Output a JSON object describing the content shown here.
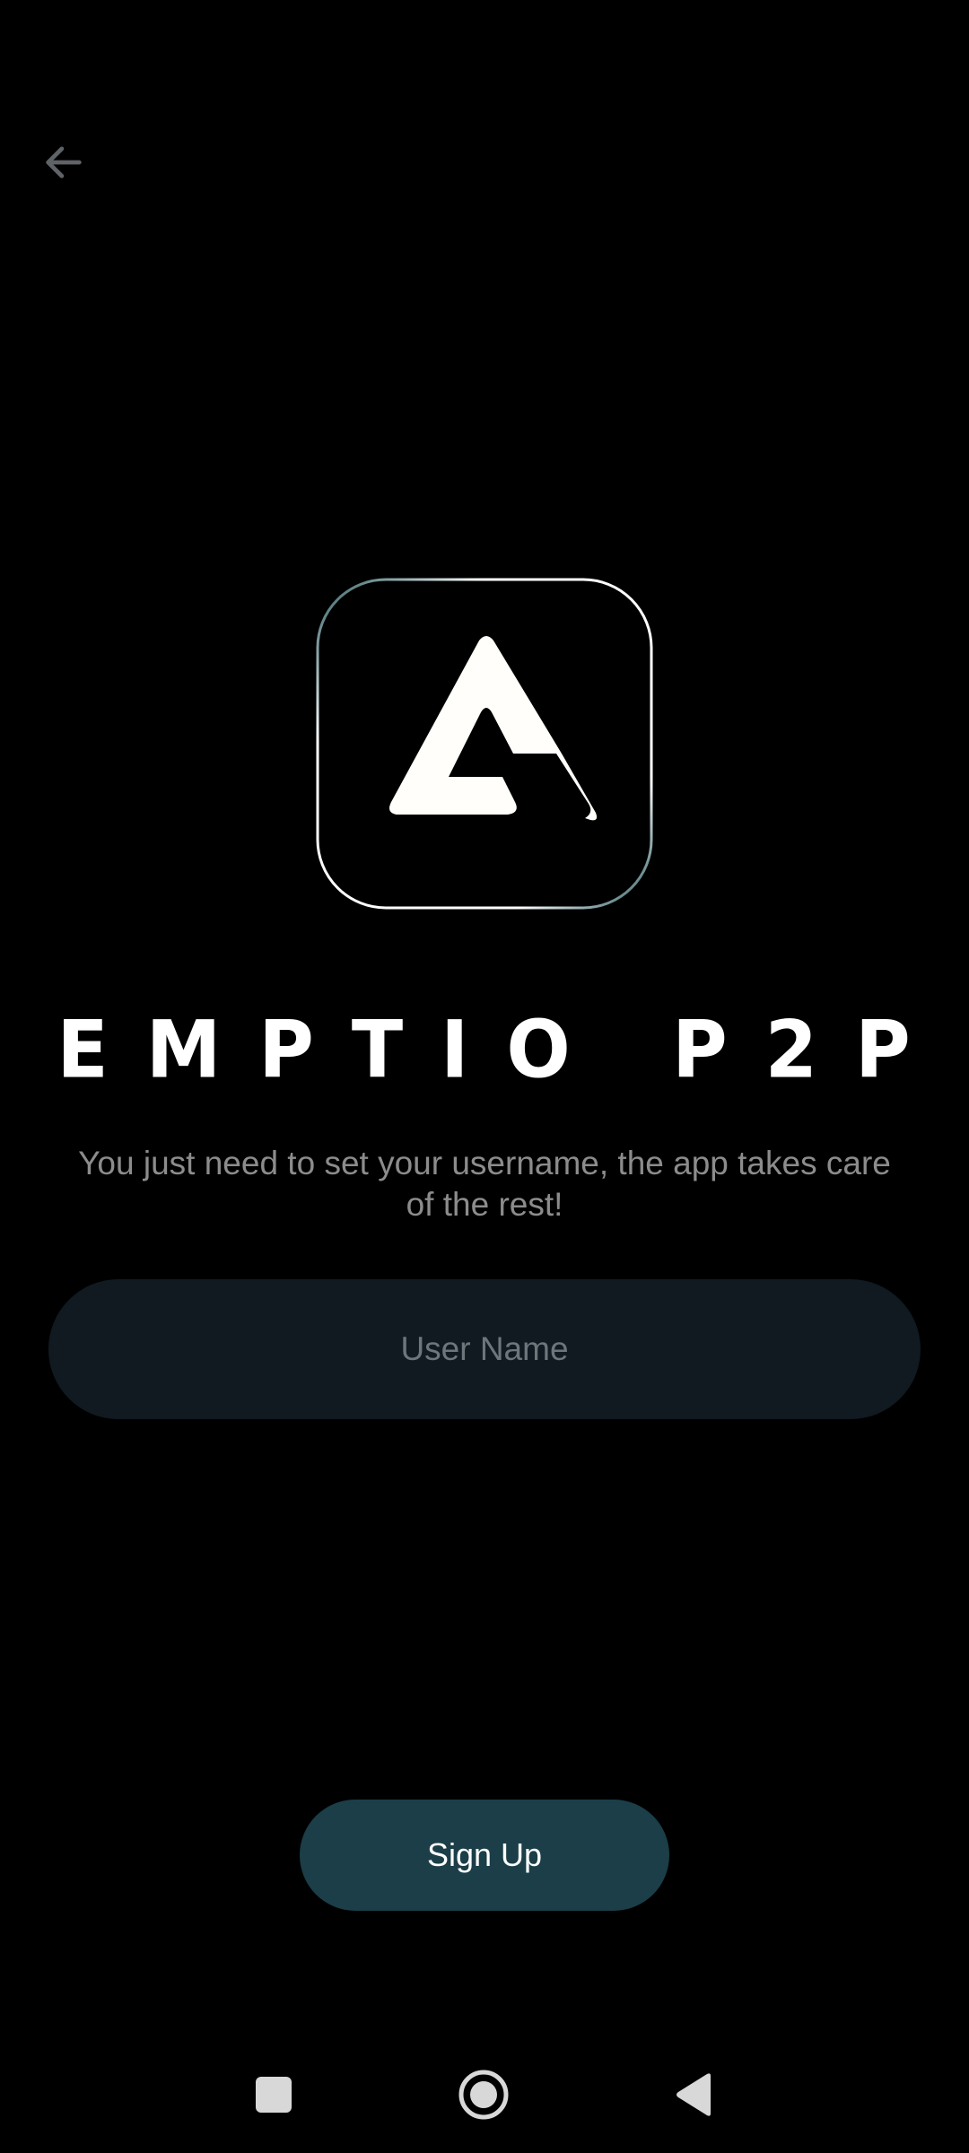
{
  "header": {
    "back_icon": "arrow-left-icon"
  },
  "logo": {
    "icon": "app-logo-triangle-icon"
  },
  "app": {
    "title": "EMPTIO P2P",
    "subtitle": "You just need to set your username, the app takes care of the rest!"
  },
  "form": {
    "username_placeholder": "User Name",
    "username_value": ""
  },
  "actions": {
    "signup_label": "Sign Up"
  },
  "system_nav": {
    "recents_icon": "square-icon",
    "home_icon": "circle-home-icon",
    "back_icon": "triangle-back-icon"
  },
  "colors": {
    "background": "#000000",
    "field_background": "#101a20",
    "button_background": "#1b3e48",
    "subtitle_text": "#8c8c8c",
    "placeholder_text": "#6d767b"
  }
}
